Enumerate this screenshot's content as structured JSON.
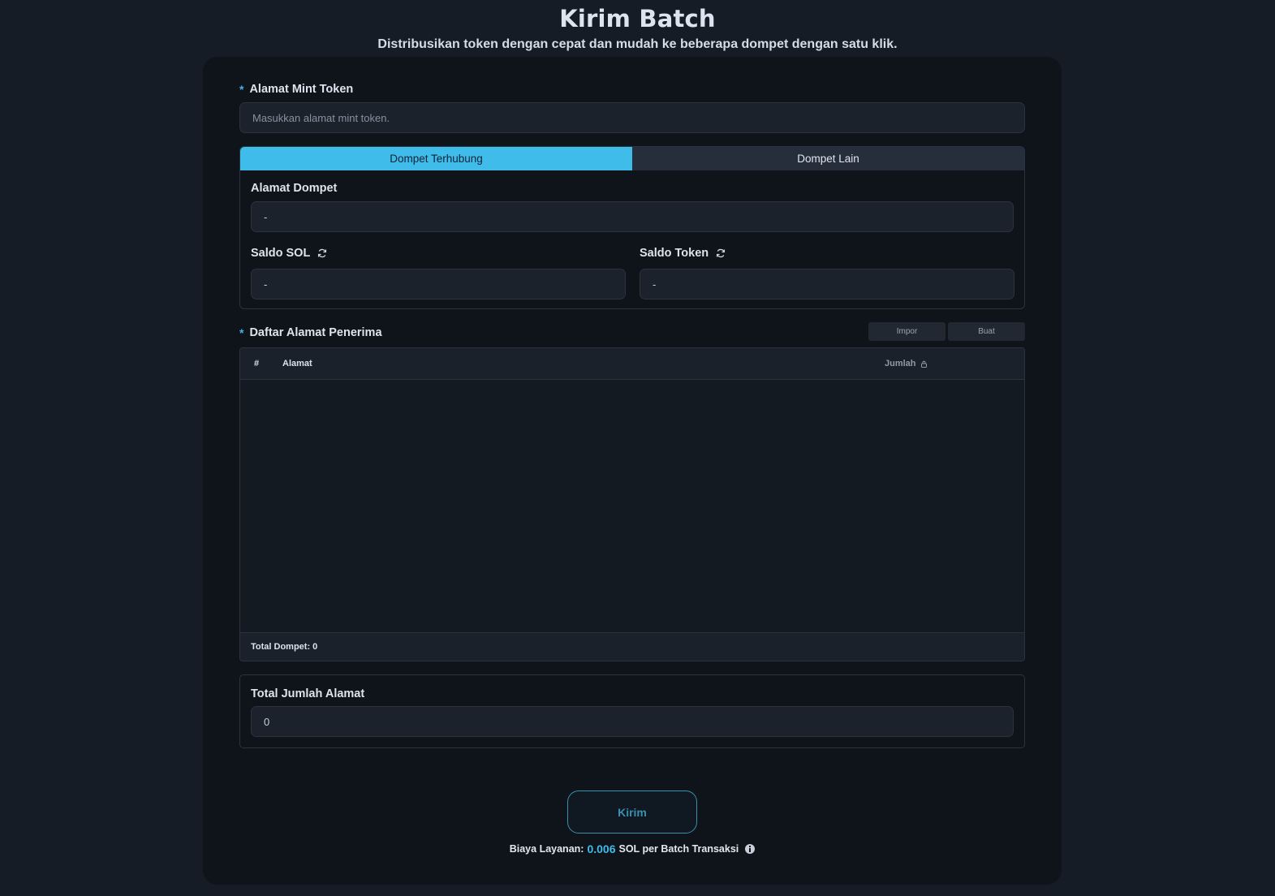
{
  "header": {
    "title": "Kirim Batch",
    "subtitle": "Distribusikan token dengan cepat dan mudah ke beberapa dompet dengan satu klik."
  },
  "mint": {
    "required_mark": "*",
    "label": "Alamat Mint Token",
    "placeholder": "Masukkan alamat mint token."
  },
  "wallet": {
    "tabs": [
      {
        "label": "Dompet Terhubung",
        "active": true
      },
      {
        "label": "Dompet Lain",
        "active": false
      }
    ],
    "address_label": "Alamat Dompet",
    "address_value": "-",
    "sol_label": "Saldo SOL",
    "sol_value": "-",
    "token_label": "Saldo Token",
    "token_value": "-"
  },
  "recipients": {
    "required_mark": "*",
    "label": "Daftar Alamat Penerima",
    "import_label": "Impor",
    "create_label": "Buat",
    "columns": [
      "#",
      "Alamat",
      "Jumlah"
    ],
    "rows": [],
    "footer": "Total Dompet: 0"
  },
  "total": {
    "label": "Total Jumlah Alamat",
    "value": "0"
  },
  "send": {
    "label": "Kirim"
  },
  "fee": {
    "prefix": "Biaya Layanan:",
    "amount": "0.006",
    "suffix": "SOL per Batch Transaksi"
  },
  "colors": {
    "accent": "#3fbce9",
    "background": "#161c25",
    "card": "#0f131a"
  }
}
